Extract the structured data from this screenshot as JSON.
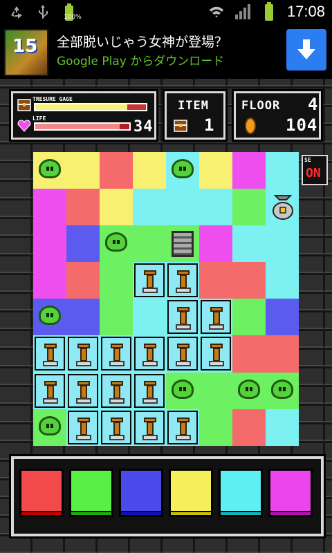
{
  "status_bar": {
    "battery_percent": "100%",
    "time": "17:08",
    "icons": [
      "recycle-icon",
      "usb-icon",
      "battery-icon",
      "wifi-icon",
      "signal-icon",
      "battery-icon"
    ]
  },
  "ad": {
    "title": "全部脱いじゃう女神が登場？",
    "subtitle": "Google Play からダウンロード",
    "thumb_number": "15",
    "button_icon": "download-arrow-icon"
  },
  "hud": {
    "treasure_label": "TRESURE GAGE",
    "treasure_level": 0.83,
    "life_label": "LIFE",
    "life_level": 0.9,
    "life_value": "34",
    "item_label": "ITEM",
    "item_count": "1",
    "floor_label": "FLOOR",
    "floor_value": "4",
    "coin_value": "104",
    "se_label": "SE",
    "se_state": "ON"
  },
  "board": {
    "colors": {
      "R": "#f56b6b",
      "G": "#6df061",
      "B": "#5b5bef",
      "Y": "#f7f071",
      "C": "#7df1f2",
      "M": "#f04ff0"
    },
    "grid": [
      [
        "Y",
        "Y",
        "R",
        "Y",
        "C",
        "Y",
        "M",
        "C"
      ],
      [
        "M",
        "R",
        "Y",
        "C",
        "C",
        "C",
        "G",
        "C"
      ],
      [
        "M",
        "B",
        "G",
        "G",
        "G",
        "M",
        "C",
        "C"
      ],
      [
        "M",
        "R",
        "G",
        "C",
        "C",
        "R",
        "R",
        "C"
      ],
      [
        "B",
        "B",
        "G",
        "C",
        "C",
        "C",
        "G",
        "B"
      ],
      [
        "C",
        "C",
        "C",
        "C",
        "C",
        "C",
        "R",
        "R"
      ],
      [
        "C",
        "C",
        "C",
        "C",
        "G",
        "G",
        "G",
        "G"
      ],
      [
        "G",
        "C",
        "C",
        "C",
        "C",
        "G",
        "R",
        "C"
      ]
    ],
    "objects": [
      [
        "slime",
        "",
        "",
        "",
        "slime",
        "",
        "",
        ""
      ],
      [
        "",
        "",
        "",
        "",
        "",
        "",
        "",
        "bag"
      ],
      [
        "",
        "",
        "slime",
        "",
        "stairs",
        "",
        "",
        ""
      ],
      [
        "",
        "",
        "",
        "pillar",
        "pillar",
        "",
        "",
        ""
      ],
      [
        "slime",
        "",
        "",
        "",
        "pillar",
        "pillar",
        "",
        ""
      ],
      [
        "pillar",
        "pillar",
        "pillar",
        "pillar",
        "pillar",
        "pillar",
        "",
        ""
      ],
      [
        "pillar",
        "pillar",
        "pillar",
        "pillar",
        "slime",
        "",
        "slime",
        "slime"
      ],
      [
        "slime",
        "pillar",
        "pillar",
        "pillar",
        "pillar",
        "",
        "",
        ""
      ]
    ]
  },
  "palette": [
    {
      "name": "red",
      "color": "#f24a4a",
      "bar": "#c40000"
    },
    {
      "name": "green",
      "color": "#58f045",
      "bar": "#1fae10"
    },
    {
      "name": "blue",
      "color": "#4b4bed",
      "bar": "#1212b8"
    },
    {
      "name": "yellow",
      "color": "#f5f05a",
      "bar": "#c6be0d"
    },
    {
      "name": "cyan",
      "color": "#5cf0f2",
      "bar": "#12b4b8"
    },
    {
      "name": "magenta",
      "color": "#ed45ed",
      "bar": "#b312b3"
    }
  ]
}
